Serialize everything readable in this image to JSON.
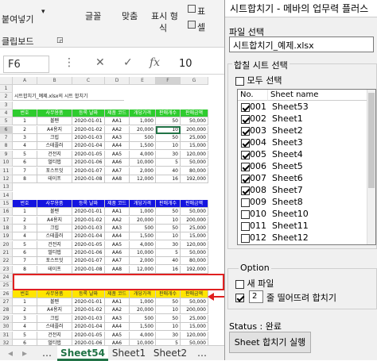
{
  "ribbon": {
    "paste_label": "붙여넣기",
    "font_group": "글꼴",
    "clipboard_group": "클립보드",
    "align_group": "맞춤",
    "number_group_1": "표시 형",
    "number_group_2": "식",
    "style_1": "표",
    "style_2": "셀"
  },
  "formula_bar": {
    "name_box": "F6",
    "fx": "fx",
    "value": "10"
  },
  "sheet": {
    "columns": [
      "A",
      "B",
      "C",
      "D",
      "E",
      "F",
      "G"
    ],
    "title_cell": "시트합치기_예제.xlsx의 시트 합치기",
    "headers": [
      "번호",
      "사무용품",
      "등록 날짜",
      "제품 코드",
      "개당가격",
      "판매개수",
      "판매금액"
    ],
    "block1": [
      [
        "1",
        "볼펜",
        "2020-01-01",
        "AA1",
        "1,000",
        "50",
        "50,000"
      ],
      [
        "2",
        "A4용지",
        "2020-01-02",
        "AA2",
        "20,000",
        "10",
        "200,000"
      ],
      [
        "3",
        "크립",
        "2020-01-03",
        "AA3",
        "500",
        "50",
        "25,000"
      ],
      [
        "4",
        "스테플러",
        "2020-01-04",
        "AA4",
        "1,500",
        "10",
        "15,000"
      ],
      [
        "5",
        "건전지",
        "2020-01-05",
        "AA5",
        "4,000",
        "30",
        "120,000"
      ],
      [
        "6",
        "멀티탭",
        "2020-01-06",
        "AA6",
        "10,000",
        "5",
        "50,000"
      ],
      [
        "7",
        "포스트잇",
        "2020-01-07",
        "AA7",
        "2,000",
        "40",
        "80,000"
      ],
      [
        "8",
        "테이프",
        "2020-01-08",
        "AA8",
        "12,000",
        "16",
        "192,000"
      ]
    ],
    "block2": [
      [
        "1",
        "볼펜",
        "2020-01-01",
        "AA1",
        "1,000",
        "50",
        "50,000"
      ],
      [
        "2",
        "A4용지",
        "2020-01-02",
        "AA2",
        "20,000",
        "10",
        "200,000"
      ],
      [
        "3",
        "크립",
        "2020-01-03",
        "AA3",
        "500",
        "50",
        "25,000"
      ],
      [
        "4",
        "스테플러",
        "2020-01-04",
        "AA4",
        "1,500",
        "10",
        "15,000"
      ],
      [
        "5",
        "건전지",
        "2020-01-05",
        "AA5",
        "4,000",
        "30",
        "120,000"
      ],
      [
        "6",
        "멀티탭",
        "2020-01-06",
        "AA6",
        "10,000",
        "5",
        "50,000"
      ],
      [
        "7",
        "포스트잇",
        "2020-01-07",
        "AA7",
        "2,000",
        "40",
        "80,000"
      ],
      [
        "8",
        "테이프",
        "2020-01-08",
        "AA8",
        "12,000",
        "16",
        "192,000"
      ]
    ],
    "block3": [
      [
        "1",
        "볼펜",
        "2020-01-01",
        "AA1",
        "1,000",
        "50",
        "50,000"
      ],
      [
        "2",
        "A4용지",
        "2020-01-02",
        "AA2",
        "20,000",
        "10",
        "200,000"
      ],
      [
        "3",
        "크립",
        "2020-01-03",
        "AA3",
        "500",
        "50",
        "25,000"
      ],
      [
        "4",
        "스테플러",
        "2020-01-04",
        "AA4",
        "1,500",
        "10",
        "15,000"
      ],
      [
        "5",
        "건전지",
        "2020-01-05",
        "AA5",
        "4,000",
        "30",
        "120,000"
      ],
      [
        "6",
        "멀티탭",
        "2020-01-06",
        "AA6",
        "10,000",
        "5",
        "50,000"
      ]
    ],
    "row_numbers": [
      "1",
      "2",
      "3",
      "4",
      "5",
      "6",
      "7",
      "8",
      "9",
      "10",
      "11",
      "12",
      "13",
      "14",
      "15",
      "16",
      "17",
      "18",
      "19",
      "20",
      "21",
      "22",
      "23",
      "24",
      "25",
      "26",
      "27",
      "28",
      "29",
      "30",
      "31",
      "32"
    ]
  },
  "tabs": [
    "Sheet54",
    "Sheet1",
    "Sheet2"
  ],
  "panel": {
    "title": "시트합치기 - 메바의 업무력 플러스",
    "file_label": "파일 선택",
    "file_value": "시트합치기_예제.xlsx",
    "merge_label": "합칠 시트 선택",
    "select_all": "모두 선택",
    "col_no": "No.",
    "col_name": "Sheet name",
    "sheets": [
      {
        "no": "001",
        "name": "Sheet53",
        "checked": true
      },
      {
        "no": "002",
        "name": "Sheet1",
        "checked": true
      },
      {
        "no": "003",
        "name": "Sheet2",
        "checked": true
      },
      {
        "no": "004",
        "name": "Sheet3",
        "checked": true
      },
      {
        "no": "005",
        "name": "Sheet4",
        "checked": true
      },
      {
        "no": "006",
        "name": "Sheet5",
        "checked": true
      },
      {
        "no": "007",
        "name": "Sheet6",
        "checked": true
      },
      {
        "no": "008",
        "name": "Sheet7",
        "checked": true
      },
      {
        "no": "009",
        "name": "Sheet8",
        "checked": false
      },
      {
        "no": "010",
        "name": "Sheet10",
        "checked": false
      },
      {
        "no": "011",
        "name": "Sheet11",
        "checked": false
      },
      {
        "no": "012",
        "name": "Sheet12",
        "checked": false
      }
    ],
    "option_label": "Option",
    "new_file": "새 파일",
    "gap_value": "2",
    "gap_label": "줄 띨어뜨려 합치기",
    "status_label": "Status : 완료",
    "run_button": "Sheet 합치기 실행"
  },
  "colors": {
    "green_header": "#2ecc2e",
    "blue_header": "#1414e0",
    "yellow_header": "#ffe500",
    "annotation_red": "#e02020",
    "active_tab": "#217346"
  }
}
